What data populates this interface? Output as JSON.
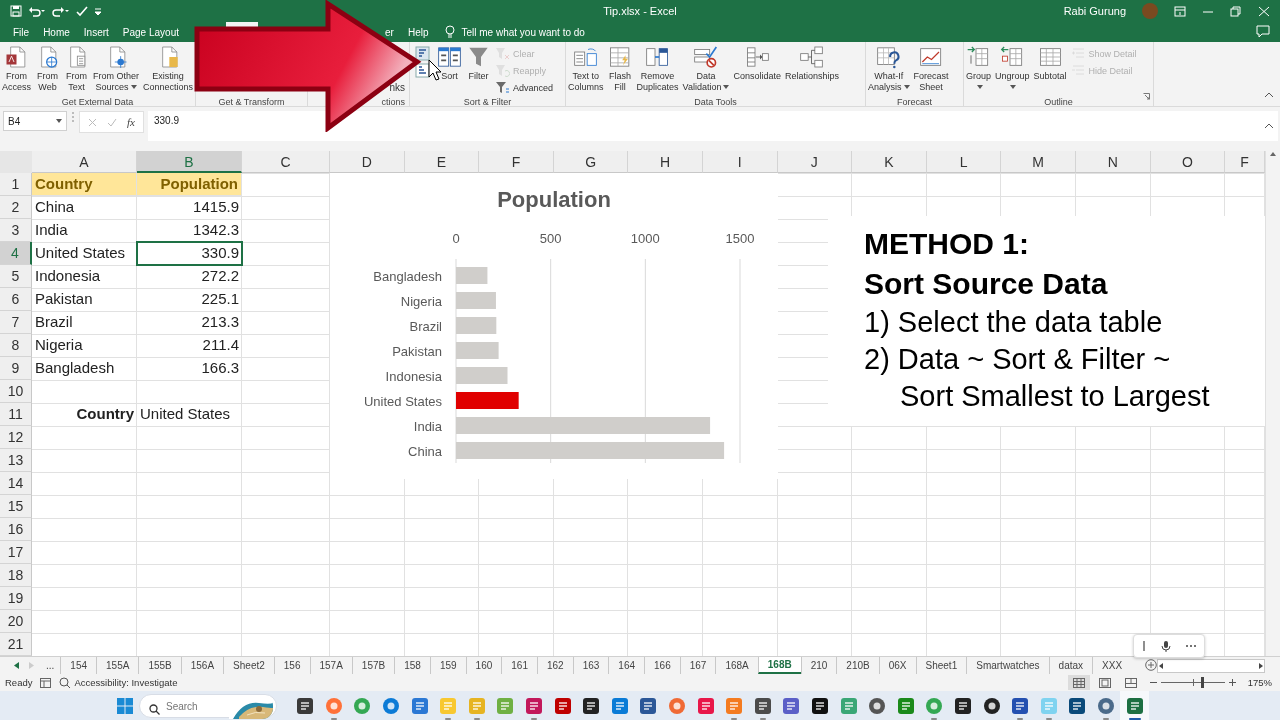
{
  "window": {
    "title": "Tip.xlsx  -  Excel",
    "user": "Rabi Gurung"
  },
  "ribbon_tabs": [
    {
      "label": "File",
      "selected": false
    },
    {
      "label": "Home",
      "selected": false
    },
    {
      "label": "Insert",
      "selected": false
    },
    {
      "label": "Page Layout",
      "selected": false
    },
    {
      "selected": true
    },
    {
      "label": "er",
      "selected": false
    },
    {
      "label": "Help",
      "selected": false
    }
  ],
  "tell_me": {
    "placeholder": "Tell me what you want to do"
  },
  "ribbon_groups": [
    {
      "label": "Get External Data",
      "launcher": false,
      "buttons": [
        {
          "kind": "large",
          "lines": [
            "From",
            "Access"
          ],
          "dropdown": false,
          "disabled": false
        },
        {
          "kind": "large",
          "lines": [
            "From",
            "Web"
          ],
          "dropdown": false,
          "disabled": false
        },
        {
          "kind": "large",
          "lines": [
            "From",
            "Text"
          ],
          "dropdown": false,
          "disabled": false
        },
        {
          "kind": "large",
          "lines": [
            "From Other",
            "Sources"
          ],
          "dropdown": true,
          "disabled": false
        },
        {
          "kind": "large",
          "lines": [
            "Existing",
            "Connections"
          ],
          "dropdown": false,
          "disabled": false
        }
      ]
    },
    {
      "label": "Get & Transform",
      "launcher": false
    },
    {
      "label": "ctions",
      "launcher": false,
      "buttons": [
        {
          "kind": "text",
          "lines": [
            "nks"
          ],
          "dropdown": false,
          "disabled": false
        }
      ]
    },
    {
      "label": "Sort & Filter",
      "launcher": false,
      "buttons": [
        {
          "kind": "icon",
          "dropdown": false,
          "disabled": false
        },
        {
          "kind": "icon",
          "dropdown": false,
          "disabled": false
        },
        {
          "kind": "large",
          "lines": [
            "Sort"
          ],
          "dropdown": false,
          "disabled": false
        },
        {
          "kind": "large",
          "lines": [
            "Filter"
          ],
          "dropdown": false,
          "disabled": false
        },
        {
          "kind": "small",
          "lines": [
            "Clear"
          ],
          "dropdown": false,
          "disabled": true
        },
        {
          "kind": "small",
          "lines": [
            "Reapply"
          ],
          "dropdown": false,
          "disabled": true
        },
        {
          "kind": "small",
          "lines": [
            "Advanced"
          ],
          "dropdown": false,
          "disabled": false
        }
      ]
    },
    {
      "label": "Data Tools",
      "launcher": false,
      "buttons": [
        {
          "kind": "large",
          "lines": [
            "Text to",
            "Columns"
          ],
          "dropdown": false,
          "disabled": false
        },
        {
          "kind": "large",
          "lines": [
            "Flash",
            "Fill"
          ],
          "dropdown": false,
          "disabled": false
        },
        {
          "kind": "large",
          "lines": [
            "Remove",
            "Duplicates"
          ],
          "dropdown": false,
          "disabled": false
        },
        {
          "kind": "large",
          "lines": [
            "Data",
            "Validation"
          ],
          "dropdown": true,
          "disabled": false
        },
        {
          "kind": "large",
          "lines": [
            "Consolidate"
          ],
          "dropdown": false,
          "disabled": false
        },
        {
          "kind": "large",
          "lines": [
            "Relationships"
          ],
          "dropdown": false,
          "disabled": false
        }
      ]
    },
    {
      "label": "Forecast",
      "launcher": false,
      "buttons": [
        {
          "kind": "large",
          "lines": [
            "What-If",
            "Analysis"
          ],
          "dropdown": true,
          "disabled": false
        },
        {
          "kind": "large",
          "lines": [
            "Forecast",
            "Sheet"
          ],
          "dropdown": false,
          "disabled": false
        }
      ]
    },
    {
      "label": "Outline",
      "launcher": true,
      "buttons": [
        {
          "kind": "large",
          "lines": [
            "Group"
          ],
          "dropdown": true,
          "disabled": false
        },
        {
          "kind": "large",
          "lines": [
            "Ungroup"
          ],
          "dropdown": true,
          "disabled": false
        },
        {
          "kind": "large",
          "lines": [
            "Subtotal"
          ],
          "dropdown": false,
          "disabled": false
        },
        {
          "kind": "small",
          "lines": [
            "Show Detail"
          ],
          "dropdown": false,
          "disabled": true
        },
        {
          "kind": "small",
          "lines": [
            "Hide Detail"
          ],
          "dropdown": false,
          "disabled": true
        }
      ]
    }
  ],
  "formula_bar": {
    "name_box": "B4",
    "function_label": "fx",
    "value": "330.9"
  },
  "columns": [
    {
      "label": "A",
      "selected": false
    },
    {
      "label": "B",
      "selected": true
    },
    {
      "label": "C",
      "selected": false
    },
    {
      "label": "D",
      "selected": false
    },
    {
      "label": "E",
      "selected": false
    },
    {
      "label": "F",
      "selected": false
    },
    {
      "label": "G",
      "selected": false
    },
    {
      "label": "H",
      "selected": false
    },
    {
      "label": "I",
      "selected": false
    },
    {
      "label": "J",
      "selected": false
    },
    {
      "label": "K",
      "selected": false
    },
    {
      "label": "L",
      "selected": false
    },
    {
      "label": "M",
      "selected": false
    },
    {
      "label": "N",
      "selected": false
    },
    {
      "label": "O",
      "selected": false
    },
    {
      "label": "F",
      "selected": false
    }
  ],
  "rows": [
    {
      "number": "1",
      "selected": false,
      "cells": [
        {
          "text": "Country",
          "kind": "header",
          "right_aligned": false,
          "selected": false
        },
        {
          "text": "Population",
          "kind": "header",
          "right_aligned": true,
          "selected": false
        }
      ]
    },
    {
      "number": "2",
      "selected": false,
      "cells": [
        {
          "text": "China",
          "kind": "plain",
          "right_aligned": false,
          "selected": false
        },
        {
          "text": "1415.9",
          "kind": "plain",
          "right_aligned": true,
          "selected": false
        }
      ]
    },
    {
      "number": "3",
      "selected": false,
      "cells": [
        {
          "text": "India",
          "kind": "plain",
          "right_aligned": false,
          "selected": false
        },
        {
          "text": "1342.3",
          "kind": "plain",
          "right_aligned": true,
          "selected": false
        }
      ]
    },
    {
      "number": "4",
      "selected": true,
      "cells": [
        {
          "text": "United States",
          "kind": "plain",
          "right_aligned": false,
          "selected": false
        },
        {
          "text": "330.9",
          "kind": "plain",
          "right_aligned": true,
          "selected": true
        }
      ]
    },
    {
      "number": "5",
      "selected": false,
      "cells": [
        {
          "text": "Indonesia",
          "kind": "plain",
          "right_aligned": false,
          "selected": false
        },
        {
          "text": "272.2",
          "kind": "plain",
          "right_aligned": true,
          "selected": false
        }
      ]
    },
    {
      "number": "6",
      "selected": false,
      "cells": [
        {
          "text": "Pakistan",
          "kind": "plain",
          "right_aligned": false,
          "selected": false
        },
        {
          "text": "225.1",
          "kind": "plain",
          "right_aligned": true,
          "selected": false
        }
      ]
    },
    {
      "number": "7",
      "selected": false,
      "cells": [
        {
          "text": "Brazil",
          "kind": "plain",
          "right_aligned": false,
          "selected": false
        },
        {
          "text": "213.3",
          "kind": "plain",
          "right_aligned": true,
          "selected": false
        }
      ]
    },
    {
      "number": "8",
      "selected": false,
      "cells": [
        {
          "text": "Nigeria",
          "kind": "plain",
          "right_aligned": false,
          "selected": false
        },
        {
          "text": "211.4",
          "kind": "plain",
          "right_aligned": true,
          "selected": false
        }
      ]
    },
    {
      "number": "9",
      "selected": false,
      "cells": [
        {
          "text": "Bangladesh",
          "kind": "plain",
          "right_aligned": false,
          "selected": false
        },
        {
          "text": "166.3",
          "kind": "plain",
          "right_aligned": true,
          "selected": false
        }
      ]
    },
    {
      "number": "10",
      "selected": false
    },
    {
      "number": "11",
      "selected": false,
      "cells": [
        {
          "text": "Country",
          "kind": "label",
          "right_aligned": true,
          "selected": false
        },
        {
          "text": "United States",
          "kind": "plain",
          "right_aligned": false,
          "selected": false
        }
      ]
    },
    {
      "number": "12",
      "selected": false
    },
    {
      "number": "13",
      "selected": false
    },
    {
      "number": "14",
      "selected": false
    },
    {
      "number": "15",
      "selected": false
    },
    {
      "number": "16",
      "selected": false
    },
    {
      "number": "17",
      "selected": false
    },
    {
      "number": "18",
      "selected": false
    },
    {
      "number": "19",
      "selected": false
    },
    {
      "number": "20",
      "selected": false
    },
    {
      "number": "21",
      "selected": false
    }
  ],
  "chart": {
    "chart_data": {
      "type": "bar",
      "orientation": "horizontal",
      "stacked": true,
      "title": "Population",
      "categories": [
        "Bangladesh",
        "Nigeria",
        "Brazil",
        "Pakistan",
        "Indonesia",
        "United States",
        "India",
        "China"
      ],
      "xlim": [
        0,
        1500
      ],
      "xticks": [
        0,
        500,
        1000,
        1500
      ],
      "series": [
        {
          "color": "#d0cecb",
          "values": [
            166,
            211,
            213,
            225,
            272,
            null,
            1342,
            1416
          ]
        },
        {
          "color": "#e00000",
          "values": [
            null,
            null,
            null,
            null,
            null,
            331,
            null,
            null
          ]
        }
      ]
    }
  },
  "note": {
    "lines": [
      {
        "kind": "heading",
        "text": "METHOD 1:"
      },
      {
        "kind": "heading",
        "text": "Sort Source Data"
      },
      {
        "kind": "step",
        "text": "1) Select the data table"
      },
      {
        "kind": "step",
        "text": "2) Data ~ Sort & Filter ~"
      },
      {
        "kind": "continuation",
        "text": "Sort Smallest to Largest"
      }
    ]
  },
  "sheet_tabs": {
    "more": "...",
    "tabs": [
      {
        "label": "154",
        "selected": false
      },
      {
        "label": "155A",
        "selected": false
      },
      {
        "label": "155B",
        "selected": false
      },
      {
        "label": "156A",
        "selected": false
      },
      {
        "label": "Sheet2",
        "selected": false
      },
      {
        "label": "156",
        "selected": false
      },
      {
        "label": "157A",
        "selected": false
      },
      {
        "label": "157B",
        "selected": false
      },
      {
        "label": "158",
        "selected": false
      },
      {
        "label": "159",
        "selected": false
      },
      {
        "label": "160",
        "selected": false
      },
      {
        "label": "161",
        "selected": false
      },
      {
        "label": "162",
        "selected": false
      },
      {
        "label": "163",
        "selected": false
      },
      {
        "label": "164",
        "selected": false
      },
      {
        "label": "166",
        "selected": false
      },
      {
        "label": "167",
        "selected": false
      },
      {
        "label": "168A",
        "selected": false
      },
      {
        "label": "168B",
        "selected": true
      },
      {
        "label": "210",
        "selected": false
      },
      {
        "label": "210B",
        "selected": false
      },
      {
        "label": "06X",
        "selected": false
      },
      {
        "label": "Sheet1",
        "selected": false
      },
      {
        "label": "Smartwatches",
        "selected": false
      },
      {
        "label": "datax",
        "selected": false
      },
      {
        "label": "XXX",
        "selected": false
      }
    ]
  },
  "status_bar": {
    "mode": "Ready",
    "accessibility": "Accessibility: Investigate",
    "views": [
      {
        "selected": true
      },
      {
        "selected": false
      },
      {
        "selected": false
      }
    ],
    "zoom_slider": {
      "level": 0.64
    },
    "zoom": "175%"
  },
  "taskbar": {
    "search": {
      "placeholder": "Search"
    },
    "apps": [
      {
        "running": false,
        "selected": false
      },
      {
        "running": true,
        "selected": false
      },
      {
        "running": false,
        "selected": false
      },
      {
        "running": false,
        "selected": false
      },
      {
        "running": false,
        "selected": false
      },
      {
        "running": true,
        "selected": false
      },
      {
        "running": true,
        "selected": false
      },
      {
        "running": false,
        "selected": false
      },
      {
        "running": true,
        "selected": false
      },
      {
        "running": false,
        "selected": false
      },
      {
        "running": false,
        "selected": false
      },
      {
        "running": false,
        "selected": false
      },
      {
        "running": false,
        "selected": false
      },
      {
        "running": false,
        "selected": false
      },
      {
        "running": false,
        "selected": false
      },
      {
        "running": true,
        "selected": false
      },
      {
        "running": true,
        "selected": false
      },
      {
        "running": false,
        "selected": false
      },
      {
        "running": false,
        "selected": false
      },
      {
        "running": false,
        "selected": false
      },
      {
        "running": false,
        "selected": false
      },
      {
        "running": false,
        "selected": false
      },
      {
        "running": true,
        "selected": false
      },
      {
        "running": false,
        "selected": false
      },
      {
        "running": false,
        "selected": false
      },
      {
        "running": true,
        "selected": false
      },
      {
        "running": true,
        "selected": false
      },
      {
        "running": false,
        "selected": false
      },
      {
        "running": true,
        "selected": false
      },
      {
        "running": true,
        "selected": true
      }
    ]
  }
}
